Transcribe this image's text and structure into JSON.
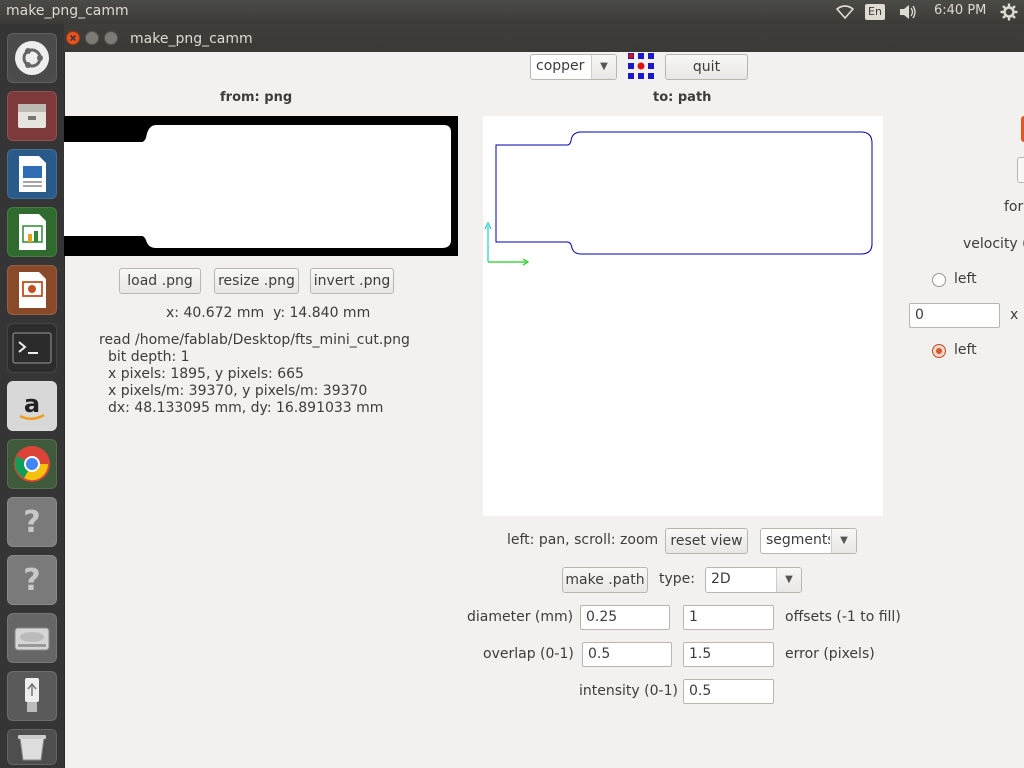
{
  "panel": {
    "app_title": "make_png_camm",
    "lang": "En",
    "clock": "6:40 PM"
  },
  "window": {
    "title": "make_png_camm"
  },
  "toolbar": {
    "process": "copper",
    "quit_label": "quit"
  },
  "from": {
    "heading": "from: png",
    "load_label": "load .png",
    "resize_label": "resize .png",
    "invert_label": "invert .png",
    "coords": "x: 40.672 mm  y: 14.840 mm",
    "info": [
      "read /home/fablab/Desktop/fts_mini_cut.png",
      "bit depth: 1",
      "x pixels: 1895, y pixels: 665",
      "x pixels/m: 39370, y pixels/m: 39370",
      "dx: 48.133095 mm, dy: 16.891033 mm"
    ]
  },
  "to": {
    "heading": "to: path",
    "view_hint": "left: pan, scroll: zoom",
    "reset_label": "reset view",
    "view_mode": "segments",
    "make_label": "make .path",
    "type_label": "type:",
    "type_value": "2D"
  },
  "params": {
    "diameter_label": "diameter (mm)",
    "diameter_value": "0.25",
    "offsets_value": "1",
    "offsets_label": "offsets (-1 to fill)",
    "overlap_label": "overlap (0-1)",
    "overlap_value": "0.5",
    "error_value": "1.5",
    "error_label": "error (pixels)",
    "intensity_label": "intensity (0-1)",
    "intensity_value": "0.5"
  },
  "right": {
    "force_label": "for",
    "velocity_label": "velocity (",
    "radio1_label": "left",
    "origin_x_value": "0",
    "x_label": "x",
    "radio2_label": "left"
  },
  "colors": {
    "path_stroke": "#0000aa",
    "axis_x": "#22cc22",
    "axis_y": "#22cccc",
    "accent": "#d8572a"
  }
}
